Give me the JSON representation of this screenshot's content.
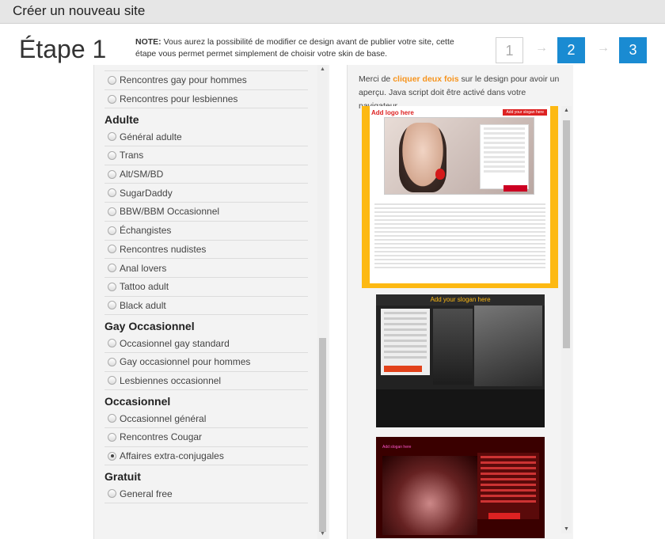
{
  "header": {
    "title": "Créer un nouveau site"
  },
  "step": {
    "title": "Étape 1",
    "note_label": "NOTE:",
    "note_text": " Vous aurez la possibilité de modifier ce design avant de publier votre site, cette étape vous permet permet simplement de choisir votre skin de base.",
    "steps": [
      "1",
      "2",
      "3"
    ],
    "arrow": "→"
  },
  "categories": {
    "top_items": [
      "Rencontres gay pour hommes",
      "Rencontres pour lesbiennes"
    ],
    "adulte": {
      "label": "Adulte",
      "items": [
        "Général adulte",
        "Trans",
        "Alt/SM/BD",
        "SugarDaddy",
        "BBW/BBM Occasionnel",
        "Échangistes",
        "Rencontres nudistes",
        "Anal lovers",
        "Tattoo adult",
        "Black adult"
      ]
    },
    "gay_occ": {
      "label": "Gay Occasionnel",
      "items": [
        "Occasionnel gay standard",
        "Gay occasionnel pour hommes",
        "Lesbiennes occasionnel"
      ]
    },
    "occasionnel": {
      "label": "Occasionnel",
      "items": [
        "Occasionnel général",
        "Rencontres Cougar",
        "Affaires extra-conjugales"
      ],
      "selected": "Affaires extra-conjugales"
    },
    "gratuit": {
      "label": "Gratuit",
      "items": [
        "General free"
      ]
    }
  },
  "preview": {
    "hint_prefix": "Merci de ",
    "hint_highlight": "cliquer deux fois",
    "hint_suffix": " sur le design pour avoir un aperçu. Java script doit être activé dans votre navigateur",
    "thumb1": {
      "logo": "Add logo here",
      "slogan": "Add your slogan here"
    },
    "thumb2": {
      "slogan": "Add your slogan here"
    },
    "thumb3": {
      "slogan": "Add slogan here"
    }
  },
  "colors": {
    "accent": "#1a8bd2",
    "highlight": "#f7941d"
  }
}
